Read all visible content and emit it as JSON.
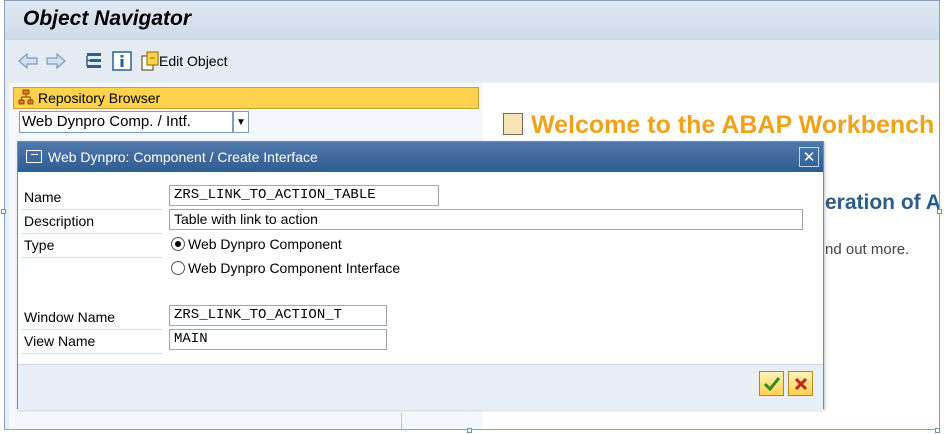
{
  "app": {
    "title": "Object Navigator"
  },
  "toolbar": {
    "edit_object_label": "Edit Object"
  },
  "repository": {
    "header": "Repository Browser",
    "selected_type": "Web Dynpro Comp. / Intf."
  },
  "right_panel": {
    "welcome": "Welcome to the ABAP Workbench",
    "heading_partial": "eration of A",
    "text_partial": "nd out more."
  },
  "dialog": {
    "title": "Web Dynpro: Component / Create Interface",
    "labels": {
      "name": "Name",
      "description": "Description",
      "type": "Type",
      "window_name": "Window Name",
      "view_name": "View Name"
    },
    "values": {
      "name": "ZRS_LINK_TO_ACTION_TABLE",
      "description": "Table with link to action",
      "window_name": "ZRS_LINK_TO_ACTION_T",
      "view_name": "MAIN"
    },
    "type_options": [
      {
        "label": "Web Dynpro Component",
        "selected": true
      },
      {
        "label": "Web Dynpro Component Interface",
        "selected": false
      }
    ]
  },
  "colors": {
    "accent_orange": "#f0a21b",
    "dialog_title_blue": "#2f5c92",
    "repo_yellow": "#ffd24d"
  }
}
